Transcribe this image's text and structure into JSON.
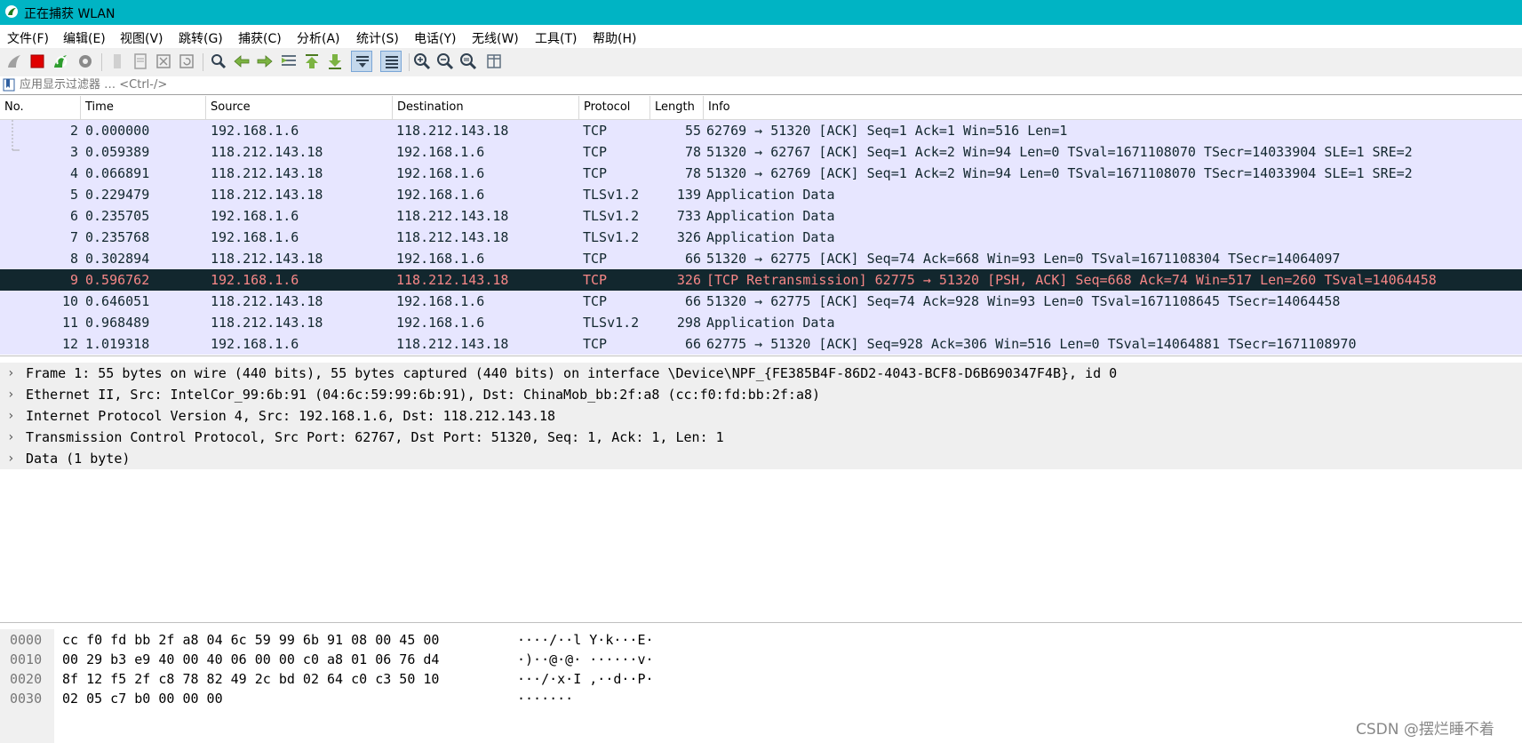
{
  "window": {
    "title": "正在捕获 WLAN"
  },
  "menu": [
    "文件(F)",
    "编辑(E)",
    "视图(V)",
    "跳转(G)",
    "捕获(C)",
    "分析(A)",
    "统计(S)",
    "电话(Y)",
    "无线(W)",
    "工具(T)",
    "帮助(H)"
  ],
  "filter": {
    "placeholder": "应用显示过滤器 … <Ctrl-/>"
  },
  "columns": [
    "No.",
    "Time",
    "Source",
    "Destination",
    "Protocol",
    "Length",
    "Info"
  ],
  "packets": [
    {
      "no": "2",
      "time": "0.000000",
      "src": "192.168.1.6",
      "dst": "118.212.143.18",
      "proto": "TCP",
      "len": "55",
      "info": "62769 → 51320 [ACK] Seq=1 Ack=1 Win=516 Len=1"
    },
    {
      "no": "3",
      "time": "0.059389",
      "src": "118.212.143.18",
      "dst": "192.168.1.6",
      "proto": "TCP",
      "len": "78",
      "info": "51320 → 62767 [ACK] Seq=1 Ack=2 Win=94 Len=0 TSval=1671108070 TSecr=14033904 SLE=1 SRE=2"
    },
    {
      "no": "4",
      "time": "0.066891",
      "src": "118.212.143.18",
      "dst": "192.168.1.6",
      "proto": "TCP",
      "len": "78",
      "info": "51320 → 62769 [ACK] Seq=1 Ack=2 Win=94 Len=0 TSval=1671108070 TSecr=14033904 SLE=1 SRE=2"
    },
    {
      "no": "5",
      "time": "0.229479",
      "src": "118.212.143.18",
      "dst": "192.168.1.6",
      "proto": "TLSv1.2",
      "len": "139",
      "info": "Application Data"
    },
    {
      "no": "6",
      "time": "0.235705",
      "src": "192.168.1.6",
      "dst": "118.212.143.18",
      "proto": "TLSv1.2",
      "len": "733",
      "info": "Application Data"
    },
    {
      "no": "7",
      "time": "0.235768",
      "src": "192.168.1.6",
      "dst": "118.212.143.18",
      "proto": "TLSv1.2",
      "len": "326",
      "info": "Application Data"
    },
    {
      "no": "8",
      "time": "0.302894",
      "src": "118.212.143.18",
      "dst": "192.168.1.6",
      "proto": "TCP",
      "len": "66",
      "info": "51320 → 62775 [ACK] Seq=74 Ack=668 Win=93 Len=0 TSval=1671108304 TSecr=14064097"
    },
    {
      "no": "9",
      "time": "0.596762",
      "src": "192.168.1.6",
      "dst": "118.212.143.18",
      "proto": "TCP",
      "len": "326",
      "info": "[TCP Retransmission] 62775 → 51320 [PSH, ACK] Seq=668 Ack=74 Win=517 Len=260 TSval=14064458"
    },
    {
      "no": "10",
      "time": "0.646051",
      "src": "118.212.143.18",
      "dst": "192.168.1.6",
      "proto": "TCP",
      "len": "66",
      "info": "51320 → 62775 [ACK] Seq=74 Ack=928 Win=93 Len=0 TSval=1671108645 TSecr=14064458"
    },
    {
      "no": "11",
      "time": "0.968489",
      "src": "118.212.143.18",
      "dst": "192.168.1.6",
      "proto": "TLSv1.2",
      "len": "298",
      "info": "Application Data"
    },
    {
      "no": "12",
      "time": "1.019318",
      "src": "192.168.1.6",
      "dst": "118.212.143.18",
      "proto": "TCP",
      "len": "66",
      "info": "62775 → 51320 [ACK] Seq=928 Ack=306 Win=516 Len=0 TSval=14064881 TSecr=1671108970"
    }
  ],
  "details": [
    "Frame 1: 55 bytes on wire (440 bits), 55 bytes captured (440 bits) on interface \\Device\\NPF_{FE385B4F-86D2-4043-BCF8-D6B690347F4B}, id 0",
    "Ethernet II, Src: IntelCor_99:6b:91 (04:6c:59:99:6b:91), Dst: ChinaMob_bb:2f:a8 (cc:f0:fd:bb:2f:a8)",
    "Internet Protocol Version 4, Src: 192.168.1.6, Dst: 118.212.143.18",
    "Transmission Control Protocol, Src Port: 62767, Dst Port: 51320, Seq: 1, Ack: 1, Len: 1",
    "Data (1 byte)"
  ],
  "bytes": [
    {
      "off": "0000",
      "hex": "cc f0 fd bb 2f a8 04 6c  59 99 6b 91 08 00 45 00",
      "ascii": "····/··l Y·k···E·"
    },
    {
      "off": "0010",
      "hex": "00 29 b3 e9 40 00 40 06  00 00 c0 a8 01 06 76 d4",
      "ascii": "·)··@·@· ······v·"
    },
    {
      "off": "0020",
      "hex": "8f 12 f5 2f c8 78 82 49  2c bd 02 64 c0 c3 50 10",
      "ascii": "···/·x·I ,··d··P·"
    },
    {
      "off": "0030",
      "hex": "02 05 c7 b0 00 00 00",
      "ascii": "·······"
    }
  ],
  "selected_packet": "9",
  "watermark": "CSDN @摆烂睡不着",
  "colors": {
    "titlebar": "#00b4c4",
    "row_tcp": "#e7e6ff",
    "row_selected_bg": "#12272e",
    "row_selected_fg": "#f78787"
  }
}
